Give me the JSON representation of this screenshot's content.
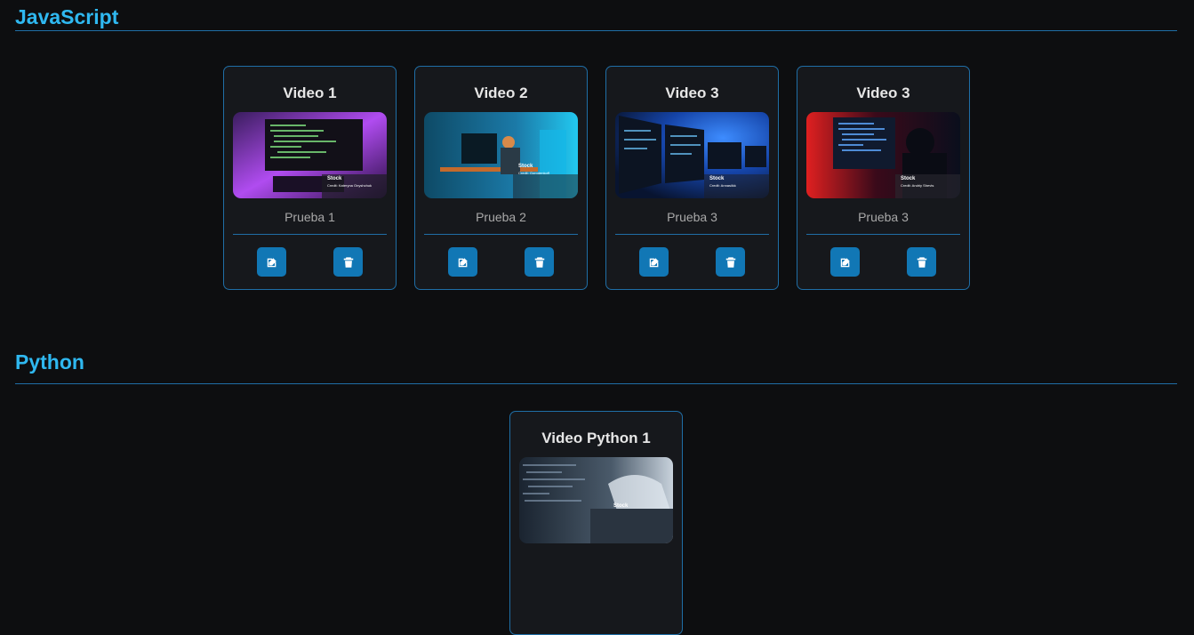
{
  "sections": [
    {
      "title": "JavaScript",
      "cards": [
        {
          "title": "Video 1",
          "description": "Prueba 1",
          "thumb": {
            "caption": "Stock",
            "credit": "Credit: Kateryna Onyshchuk",
            "accent": "#b04cf0"
          }
        },
        {
          "title": "Video 2",
          "description": "Prueba 2",
          "thumb": {
            "caption": "Stock",
            "credit": "Credit: Gorodenkoff",
            "accent": "#22c8f0"
          }
        },
        {
          "title": "Video 3",
          "description": "Prueba 3",
          "thumb": {
            "caption": "Stock",
            "credit": "Credit: Annasiikk",
            "accent": "#1e6ef0"
          }
        },
        {
          "title": "Video 3",
          "description": "Prueba 3",
          "thumb": {
            "caption": "Stock",
            "credit": "Credit: Andriy Shevts",
            "accent": "#e02020"
          }
        }
      ]
    },
    {
      "title": "Python",
      "cards": [
        {
          "title": "Video Python 1",
          "description": "",
          "thumb": {
            "caption": "Stock",
            "credit": "",
            "accent": "#8aa0b8"
          }
        }
      ]
    }
  ],
  "icons": {
    "edit": "edit-icon",
    "delete": "trash-icon"
  },
  "colors": {
    "accent": "#2fb8f0",
    "border": "#1f6ea6",
    "button": "#1177b5",
    "background": "#0d0e10",
    "card": "#16181c"
  }
}
